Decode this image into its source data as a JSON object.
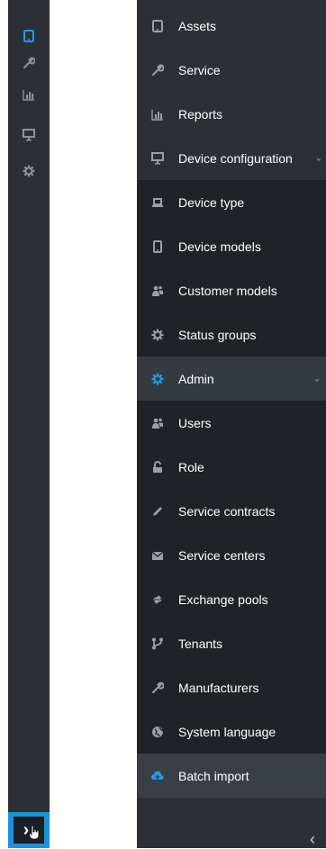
{
  "rail": {
    "icons": [
      "tablet-icon",
      "wrench-icon",
      "bar-chart-icon",
      "monitor-icon",
      "gear-icon"
    ],
    "active_color": "#1e9be9",
    "expand_symbol": "›"
  },
  "panel": {
    "items": [
      {
        "label": "Assets",
        "icon": "tablet-icon"
      },
      {
        "label": "Service",
        "icon": "wrench-icon"
      },
      {
        "label": "Reports",
        "icon": "bar-chart-icon"
      },
      {
        "label": "Device configuration",
        "icon": "monitor-icon",
        "caret": "⌄"
      },
      {
        "label": "Device type",
        "icon": "laptop-icon"
      },
      {
        "label": "Device models",
        "icon": "tablet-icon"
      },
      {
        "label": "Customer models",
        "icon": "users-icon"
      },
      {
        "label": "Status groups",
        "icon": "gear-icon"
      },
      {
        "label": "Admin",
        "icon": "gear-icon",
        "caret": "⌄"
      },
      {
        "label": "Users",
        "icon": "users-icon"
      },
      {
        "label": "Role",
        "icon": "lock-icon"
      },
      {
        "label": "Service contracts",
        "icon": "pencil-icon"
      },
      {
        "label": "Service centers",
        "icon": "envelope-icon"
      },
      {
        "label": "Exchange pools",
        "icon": "exchange-icon"
      },
      {
        "label": "Tenants",
        "icon": "fork-icon"
      },
      {
        "label": "Manufacturers",
        "icon": "wrench-icon"
      },
      {
        "label": "System language",
        "icon": "globe-icon"
      },
      {
        "label": "Batch import",
        "icon": "cloud-upload-icon"
      }
    ],
    "collapse_symbol": "‹"
  }
}
